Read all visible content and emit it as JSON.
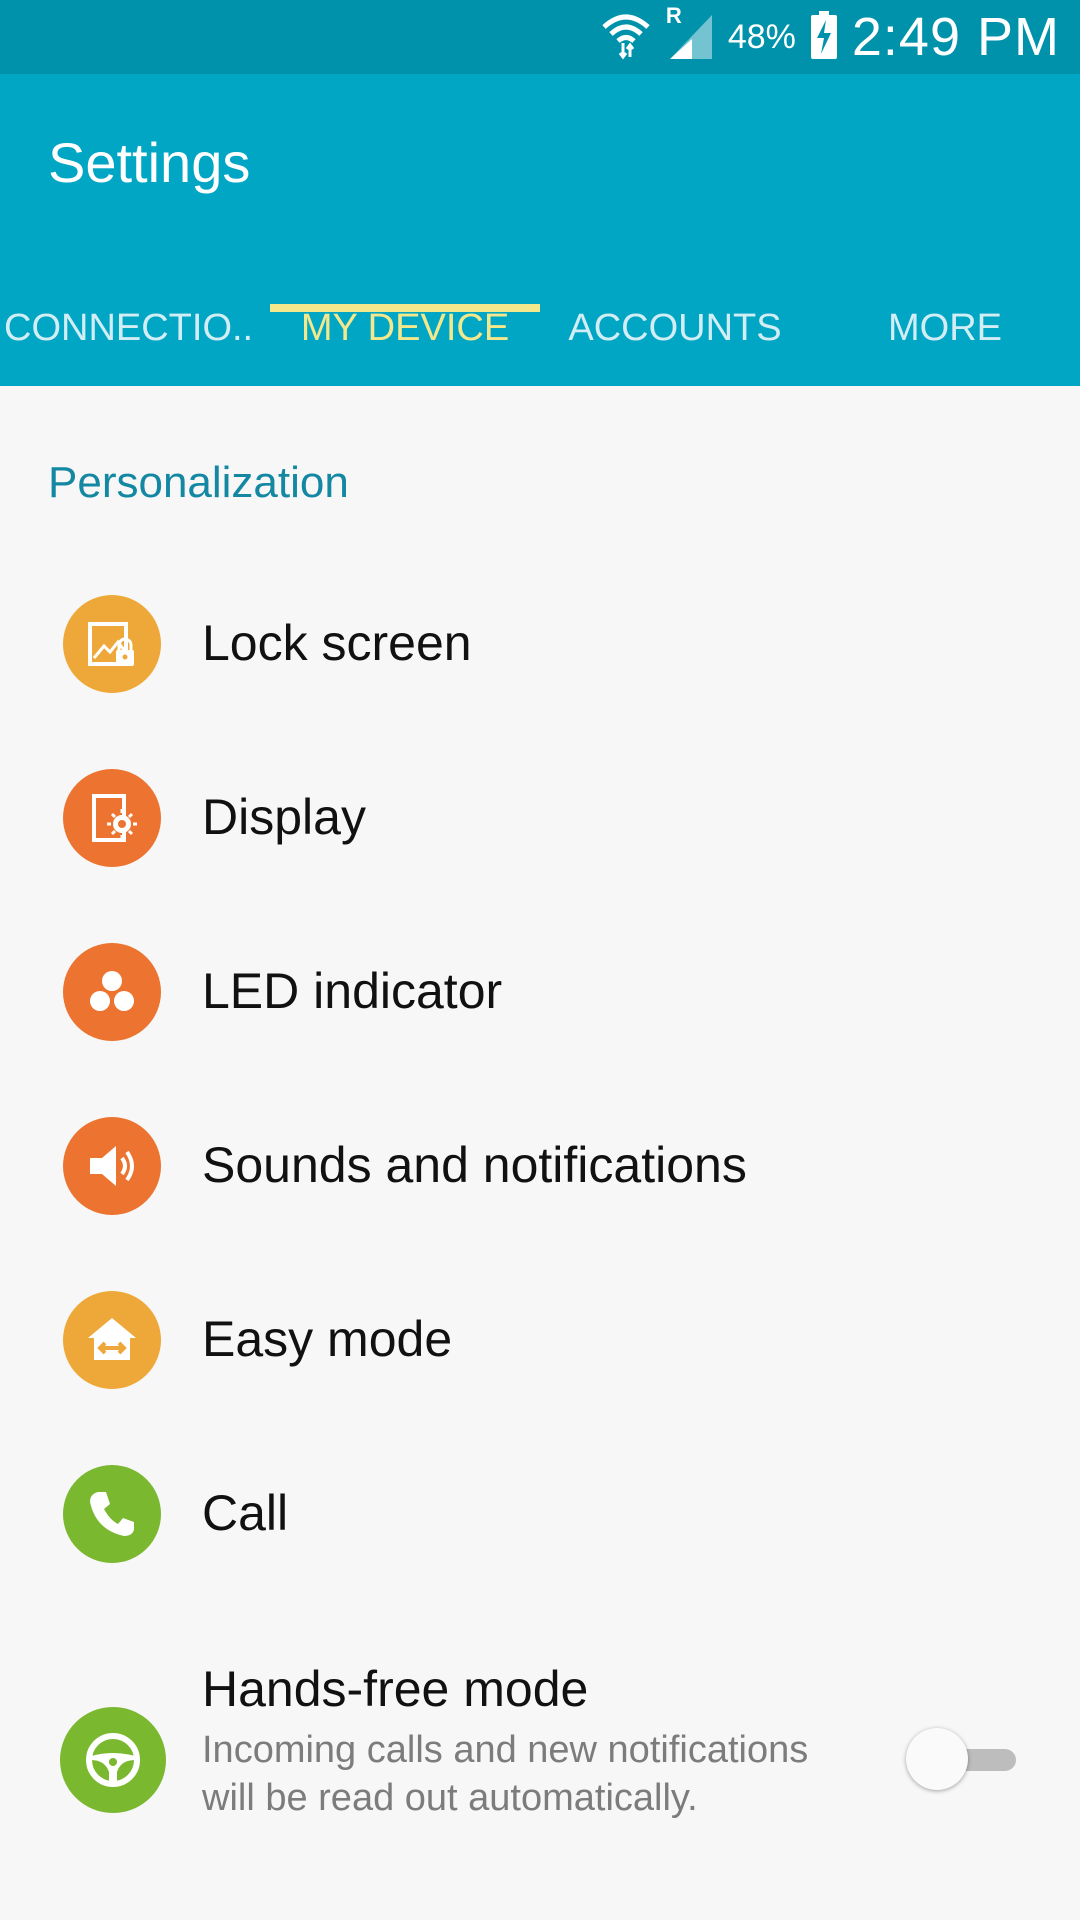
{
  "status_bar": {
    "battery_percent": "48%",
    "time": "2:49 PM",
    "roaming_indicator": "R",
    "icons": [
      "wifi-icon",
      "signal-icon",
      "battery-charging-icon"
    ]
  },
  "header": {
    "title": "Settings"
  },
  "tabs": [
    {
      "label": "CONNECTIO..",
      "active": false
    },
    {
      "label": "MY DEVICE",
      "active": true
    },
    {
      "label": "ACCOUNTS",
      "active": false
    },
    {
      "label": "MORE",
      "active": false
    }
  ],
  "section": {
    "title": "Personalization"
  },
  "items": [
    {
      "label": "Lock screen",
      "icon": "lock-screen-icon",
      "color": "#eea83a"
    },
    {
      "label": "Display",
      "icon": "display-icon",
      "color": "#ec7430"
    },
    {
      "label": "LED indicator",
      "icon": "led-indicator-icon",
      "color": "#ec7430"
    },
    {
      "label": "Sounds and notifications",
      "icon": "speaker-icon",
      "color": "#ec7430"
    },
    {
      "label": "Easy mode",
      "icon": "easy-mode-icon",
      "color": "#eea83a"
    },
    {
      "label": "Call",
      "icon": "phone-icon",
      "color": "#7ab830"
    },
    {
      "label": "Hands-free mode",
      "description": "Incoming calls and new notifications will be read out automatically.",
      "icon": "steering-wheel-icon",
      "color": "#7ab830",
      "toggle_on": false
    }
  ],
  "colors": {
    "status_bar": "#0092ab",
    "app_bar": "#00a6c4",
    "tab_active": "#f3e88c",
    "section_header": "#1487a3"
  }
}
